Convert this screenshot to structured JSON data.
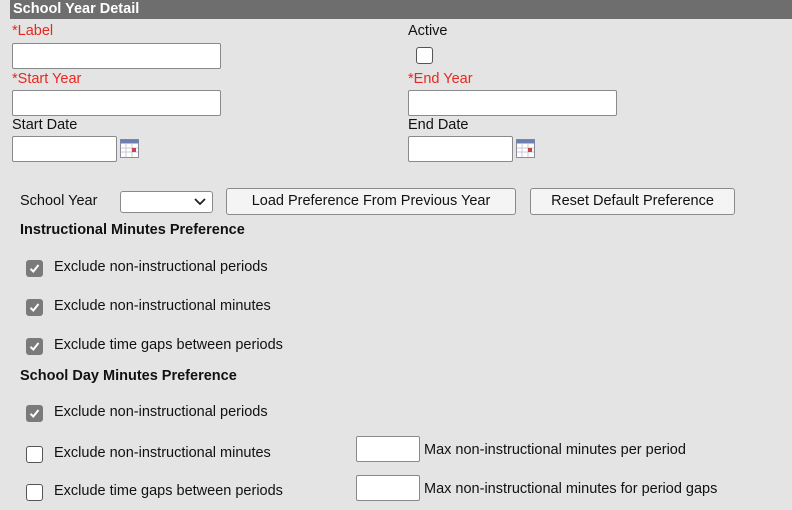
{
  "header": {
    "title": "School Year Detail"
  },
  "form": {
    "label": {
      "required_mark": "*",
      "text": "Label",
      "value": ""
    },
    "active": {
      "text": "Active",
      "checked": false
    },
    "start_year": {
      "required_mark": "*",
      "text": "Start Year",
      "value": ""
    },
    "end_year": {
      "required_mark": "*",
      "text": "End Year",
      "value": ""
    },
    "start_date": {
      "text": "Start Date",
      "value": ""
    },
    "end_date": {
      "text": "End Date",
      "value": ""
    }
  },
  "preferences": {
    "school_year_label": "School Year",
    "school_year_value": "",
    "load_button": "Load Preference From Previous Year",
    "reset_button": "Reset Default Preference",
    "instructional": {
      "title": "Instructional Minutes Preference",
      "items": [
        {
          "label": "Exclude non-instructional periods",
          "checked": true
        },
        {
          "label": "Exclude non-instructional minutes",
          "checked": true
        },
        {
          "label": "Exclude time gaps between periods",
          "checked": true
        }
      ]
    },
    "school_day": {
      "title": "School Day Minutes Preference",
      "items": [
        {
          "label": "Exclude non-instructional periods",
          "checked": true
        },
        {
          "label": "Exclude non-instructional minutes",
          "checked": false
        },
        {
          "label": "Exclude time gaps between periods",
          "checked": false
        }
      ],
      "max_period_label": "Max non-instructional minutes per period",
      "max_gaps_label": "Max non-instructional minutes for period gaps",
      "max_period_value": "",
      "max_gaps_value": ""
    }
  },
  "colors": {
    "required": "#e8281f",
    "header_bg": "#6e6e6e",
    "page_bg": "#e4e4e4"
  }
}
